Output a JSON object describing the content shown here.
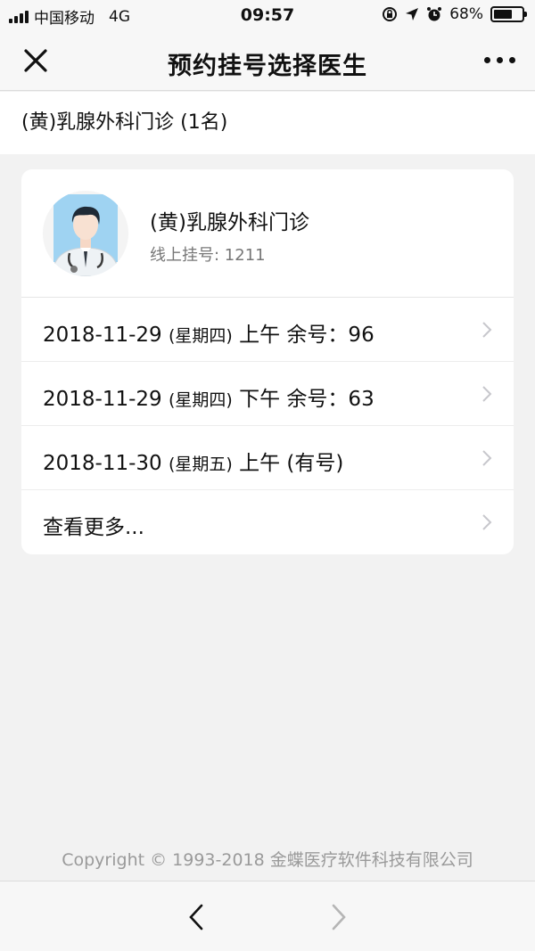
{
  "status_bar": {
    "carrier": "中国移动",
    "network": "4G",
    "time": "09:57",
    "battery_percent": "68%",
    "battery_level": 0.68
  },
  "nav": {
    "title": "预约挂号选择医生",
    "close_icon": "close-icon",
    "more_icon": "more-icon"
  },
  "department_header": "(黄)乳腺外科门诊 (1名)",
  "doctor": {
    "name": "(黄)乳腺外科门诊",
    "online_count": "线上挂号: 1211",
    "avatar_icon": "doctor-avatar-icon"
  },
  "schedule": [
    {
      "date": "2018-11-29",
      "weekday": "(星期四)",
      "slot": "上午 余号：96"
    },
    {
      "date": "2018-11-29",
      "weekday": "(星期四)",
      "slot": "下午 余号：63"
    },
    {
      "date": "2018-11-30",
      "weekday": "(星期五)",
      "slot": "上午 (有号)"
    }
  ],
  "more_label": "查看更多...",
  "copyright": "Copyright © 1993-2018 金蝶医疗软件科技有限公司",
  "colors": {
    "background": "#f2f2f2",
    "card": "#ffffff",
    "secondary_text": "#777777",
    "avatar_bg": "#9fd3f2"
  }
}
